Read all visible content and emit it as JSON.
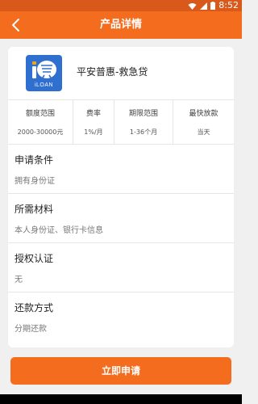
{
  "status_bar": {
    "time": "8:52"
  },
  "app_bar": {
    "title": "产品详情",
    "back_icon": "chevron-left-icon"
  },
  "product": {
    "name": "平安普惠-救急贷",
    "logo_glyph": "i贷",
    "logo_sub": "iLOAN",
    "logo_color": "#2f6fd0"
  },
  "stats": [
    {
      "label": "额度范围",
      "value": "2000-30000元"
    },
    {
      "label": "费率",
      "value": "1%/月"
    },
    {
      "label": "期限范围",
      "value": "1-36个月"
    },
    {
      "label": "最快放款",
      "value": "当天"
    }
  ],
  "sections": [
    {
      "title": "申请条件",
      "value": "拥有身份证"
    },
    {
      "title": "所需材料",
      "value": "本人身份证、银行卡信息"
    },
    {
      "title": "授权认证",
      "value": "无"
    },
    {
      "title": "还款方式",
      "value": "分期还款"
    }
  ],
  "apply_button": {
    "label": "立即申请"
  },
  "colors": {
    "accent": "#f46d1f",
    "status_bar": "#d9591a"
  }
}
